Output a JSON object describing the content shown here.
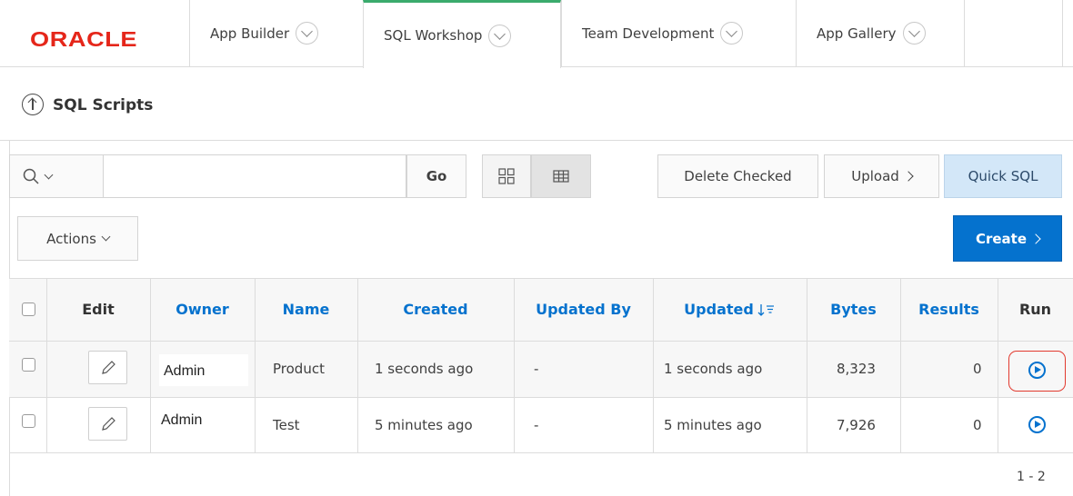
{
  "brand": {
    "logo_text": "ORACLE",
    "logo_color": "#e5261a"
  },
  "nav": {
    "tabs": [
      {
        "label": "App Builder",
        "active": false
      },
      {
        "label": "SQL Workshop",
        "active": true
      },
      {
        "label": "Team Development",
        "active": false
      },
      {
        "label": "App Gallery",
        "active": false
      }
    ]
  },
  "page": {
    "title": "SQL Scripts"
  },
  "toolbar": {
    "search_value": "",
    "go_label": "Go",
    "delete_label": "Delete Checked",
    "upload_label": "Upload",
    "quicksql_label": "Quick SQL",
    "actions_label": "Actions",
    "create_label": "Create",
    "active_view": "report"
  },
  "table": {
    "headers": {
      "edit": "Edit",
      "owner": "Owner",
      "name": "Name",
      "created": "Created",
      "updated_by": "Updated By",
      "updated": "Updated",
      "bytes": "Bytes",
      "results": "Results",
      "run": "Run"
    },
    "sort": {
      "column": "Updated",
      "direction": "descending"
    },
    "rows": [
      {
        "owner": "Admin",
        "name": "Product",
        "created": "1 seconds ago",
        "updated_by": "-",
        "updated": "1 seconds ago",
        "bytes": "8,323",
        "results": "0"
      },
      {
        "owner": "Admin",
        "name": "Test",
        "created": "5 minutes ago",
        "updated_by": "-",
        "updated": "5 minutes ago",
        "bytes": "7,926",
        "results": "0"
      }
    ],
    "pagination": "1 - 2"
  },
  "colors": {
    "accent": "#0572ce",
    "active_tab": "#3aab6d",
    "highlight": "#e23a2f"
  }
}
